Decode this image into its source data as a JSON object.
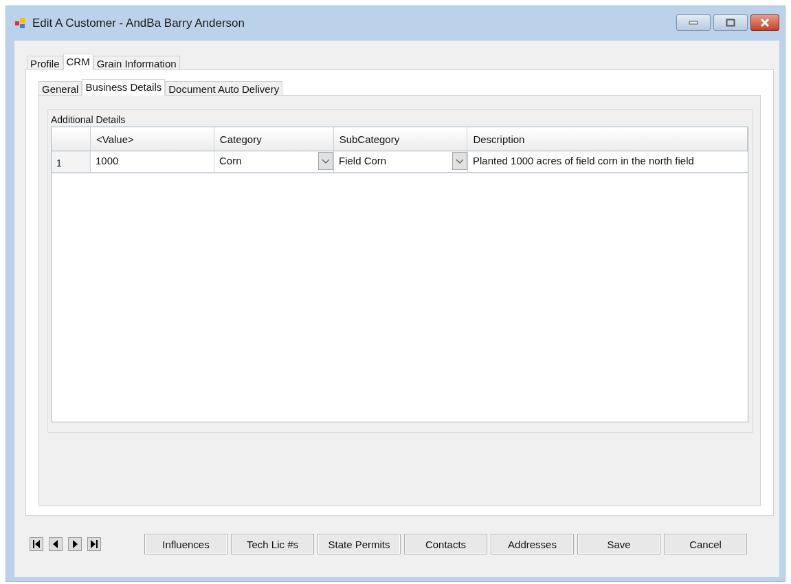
{
  "window": {
    "title": "Edit A Customer - AndBa Barry Anderson"
  },
  "tabs": [
    {
      "label": "Profile",
      "selected": false
    },
    {
      "label": "CRM",
      "selected": true
    },
    {
      "label": "Grain Information",
      "selected": false
    }
  ],
  "subtabs": [
    {
      "label": "General",
      "selected": false
    },
    {
      "label": "Business Details",
      "selected": true
    },
    {
      "label": "Document Auto Delivery",
      "selected": false
    }
  ],
  "group": {
    "title": "Additional Details"
  },
  "table": {
    "columns": [
      "<Value>",
      "Category",
      "SubCategory",
      "Description"
    ],
    "rows": [
      {
        "number": "1",
        "cells": [
          {
            "kind": "text",
            "text": "1000"
          },
          {
            "kind": "combo",
            "text": "Corn"
          },
          {
            "kind": "combo",
            "text": "Field Corn"
          },
          {
            "kind": "text",
            "text": "Planted 1000 acres of field corn in the north field"
          }
        ]
      }
    ]
  },
  "buttons": [
    "Influences",
    "Tech Lic #s",
    "State Permits",
    "Contacts",
    "Addresses",
    "Save",
    "Cancel"
  ]
}
